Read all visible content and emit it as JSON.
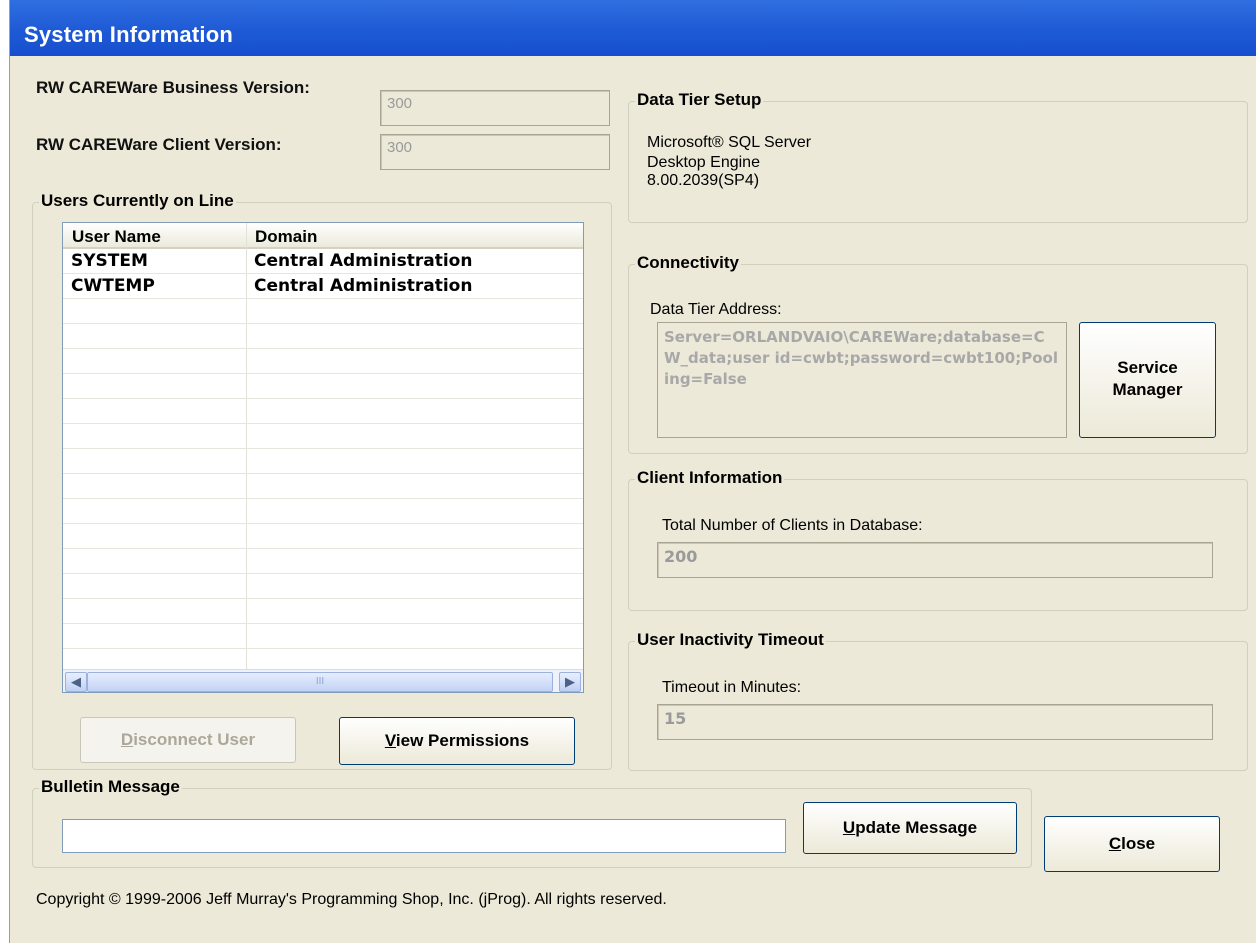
{
  "window": {
    "title": "System Information"
  },
  "versions": {
    "business_label": "RW CAREWare Business Version:",
    "business_value": "300",
    "client_label": "RW CAREWare Client Version:",
    "client_value": "300"
  },
  "users": {
    "group_title": "Users Currently on Line",
    "columns": [
      "User Name",
      "Domain"
    ],
    "rows": [
      {
        "user": "SYSTEM",
        "domain": "Central Administration"
      },
      {
        "user": "CWTEMP",
        "domain": "Central Administration"
      }
    ],
    "scroll_grip": "III",
    "disconnect_prefix": "",
    "disconnect_accel": "D",
    "disconnect_rest": "isconnect User",
    "view_accel": "V",
    "view_rest": "iew Permissions"
  },
  "data_tier": {
    "group_title": "Data Tier Setup",
    "line1": "Microsoft® SQL Server",
    "line2": "Desktop Engine",
    "line3": "8.00.2039(SP4)"
  },
  "connectivity": {
    "group_title": "Connectivity",
    "address_label": "Data Tier Address:",
    "address_value": "Server=ORLANDVAIO\\CAREWare;database=CW_data;user id=cwbt;password=cwbt100;Pooling=False",
    "service_line1": "Service",
    "service_line2": "Manager"
  },
  "client_info": {
    "group_title": "Client Information",
    "label": "Total Number of Clients in Database:",
    "value": "200"
  },
  "timeout": {
    "group_title": "User Inactivity Timeout",
    "label": "Timeout in Minutes:",
    "value": "15"
  },
  "bulletin": {
    "group_title": "Bulletin Message",
    "value": "",
    "update_accel": "U",
    "update_rest": "pdate Message"
  },
  "close": {
    "accel": "C",
    "rest": "lose"
  },
  "footer": {
    "copyright": "Copyright © 1999-2006 Jeff Murray's Programming Shop, Inc. (jProg). All rights reserved."
  },
  "colors": {
    "title_bar": "#0e46c6",
    "face": "#ece9d8",
    "button_border": "#003c74"
  }
}
